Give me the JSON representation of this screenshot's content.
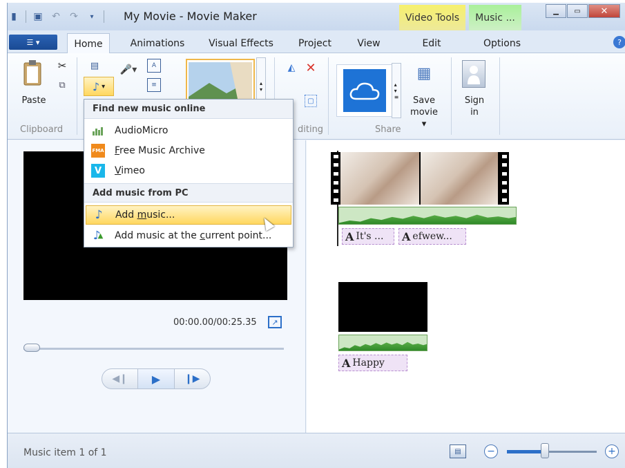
{
  "window": {
    "title": "My Movie - Movie Maker",
    "context_tabs": {
      "video_tools": "Video Tools",
      "music": "Music ..."
    }
  },
  "tabs": [
    "Home",
    "Animations",
    "Visual Effects",
    "Project",
    "View",
    "Edit",
    "Options"
  ],
  "ribbon": {
    "paste_label": "Paste",
    "clipboard_group": "Clipboard",
    "editing_group_partial": "diting",
    "share_group": "Share",
    "save_movie_label": "Save",
    "save_movie_label2": "movie",
    "sign_in_label": "Sign",
    "sign_in_label2": "in"
  },
  "menu": {
    "header_online": "Find new music online",
    "online_items": [
      {
        "prefix": "",
        "accel": "",
        "rest": "AudioMicro",
        "icon": "bars-icon"
      },
      {
        "prefix": "",
        "accel": "F",
        "rest": "ree Music Archive",
        "icon": "fma-icon",
        "badge": "FMA"
      },
      {
        "prefix": "",
        "accel": "V",
        "rest": "imeo",
        "icon": "vimeo-icon",
        "badge": "V"
      }
    ],
    "header_pc": "Add music from PC",
    "pc_items": [
      {
        "prefix": "Add ",
        "accel": "m",
        "rest": "usic...",
        "icon": "music-note-icon"
      },
      {
        "prefix": "Add music at the ",
        "accel": "c",
        "rest": "urrent point...",
        "icon": "music-add-icon"
      }
    ],
    "highlighted_index": 0
  },
  "preview": {
    "timecode": "00:00.00/00:25.35",
    "seek_position": 0.0
  },
  "storyboard": {
    "captions_clip1": [
      "It's ...",
      "efwew..."
    ],
    "caption_clip2": "Happy",
    "caption_glyph": "A"
  },
  "status": {
    "text": "Music item 1 of 1",
    "zoom_level": 0.4
  },
  "colors": {
    "ribbon_blue": "#2c6fc8",
    "video_tools": "#f6f06d",
    "music_tools": "#a9f09a",
    "menu_highlight": "#ffd75f"
  }
}
